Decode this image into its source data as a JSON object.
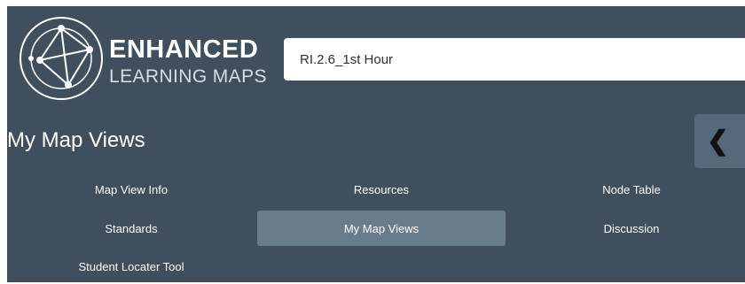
{
  "brand": {
    "name_top": "ENHANCED",
    "name_bottom": "LEARNING MAPS",
    "logo_icon": "network-circle-logo-icon"
  },
  "map_view": {
    "title_value": "RI.2.6_1st Hour"
  },
  "section": {
    "title": "My Map Views"
  },
  "collapse": {
    "icon": "chevron-left-icon",
    "glyph": "❮"
  },
  "nav": {
    "items": [
      {
        "label": "Map View Info",
        "active": false
      },
      {
        "label": "Resources",
        "active": false
      },
      {
        "label": "Node Table",
        "active": false
      },
      {
        "label": "Standards",
        "active": false
      },
      {
        "label": "My Map Views",
        "active": true
      },
      {
        "label": "Discussion",
        "active": false
      },
      {
        "label": "Student Locater Tool",
        "active": false
      }
    ]
  },
  "colors": {
    "panel_bg": "#3f4f5e",
    "active_tab_bg": "#687c8c",
    "collapse_bg": "#56697a",
    "text": "#ffffff"
  }
}
